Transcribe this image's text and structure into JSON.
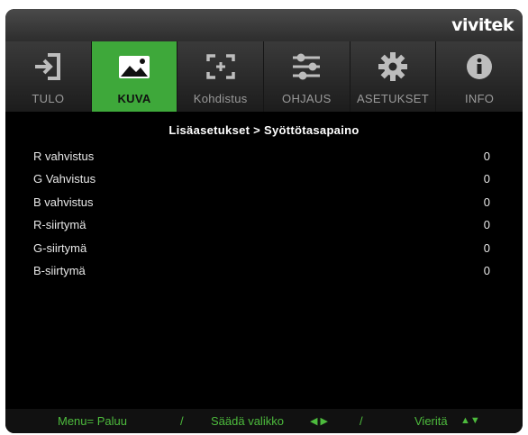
{
  "brand": "vivitek",
  "tabs": [
    {
      "label": "TULO",
      "icon": "input-icon"
    },
    {
      "label": "KUVA",
      "icon": "image-icon"
    },
    {
      "label": "Kohdistus",
      "icon": "focus-icon"
    },
    {
      "label": "OHJAUS",
      "icon": "sliders-icon"
    },
    {
      "label": "ASETUKSET",
      "icon": "gear-icon"
    },
    {
      "label": "INFO",
      "icon": "info-icon"
    }
  ],
  "active_tab": "KUVA",
  "breadcrumb": "Lisäasetukset > Syöttötasapaino",
  "rows": [
    {
      "name": "R vahvistus",
      "value": "0"
    },
    {
      "name": "G Vahvistus",
      "value": "0"
    },
    {
      "name": "B vahvistus",
      "value": "0"
    },
    {
      "name": "R-siirtymä",
      "value": "0"
    },
    {
      "name": "G-siirtymä",
      "value": "0"
    },
    {
      "name": "B-siirtymä",
      "value": "0"
    }
  ],
  "footer": {
    "menu": "Menu= Paluu",
    "sep1": "/",
    "adjust": "Säädä valikko",
    "adjust_arrows": "◀ ▶",
    "sep2": "/",
    "scroll": "Vieritä",
    "scroll_arrows": "▲▼"
  },
  "colors": {
    "accent": "#3ea83a",
    "footer_text": "#4dbb3d",
    "background": "#000000"
  }
}
